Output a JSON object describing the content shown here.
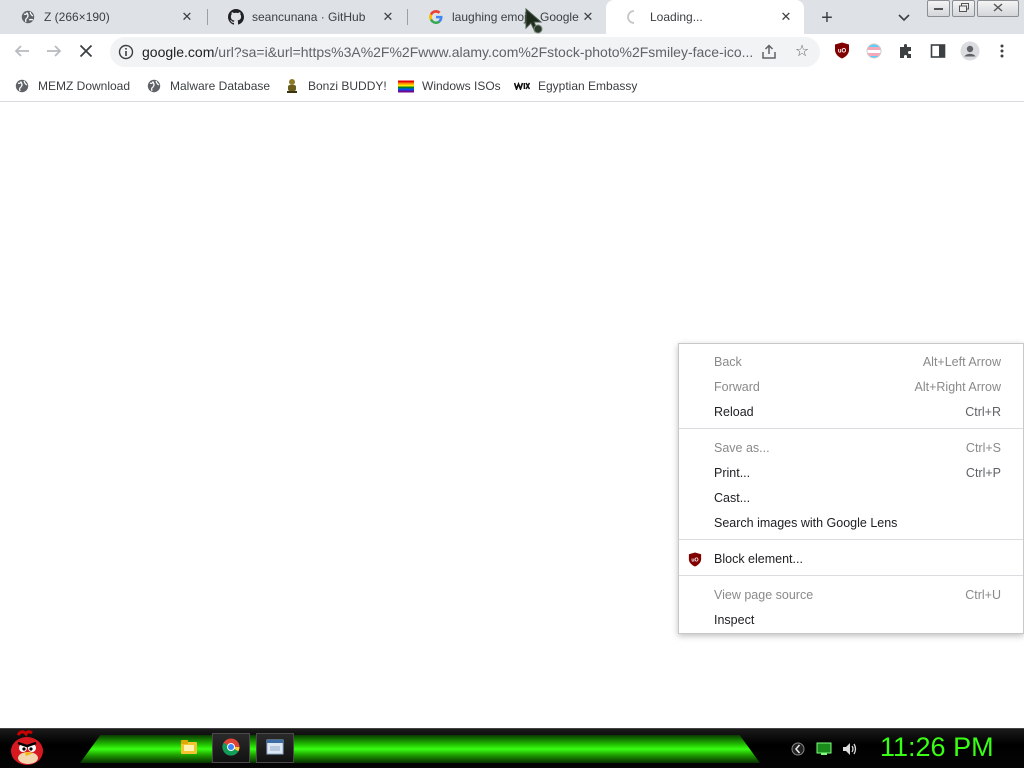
{
  "browser": {
    "tabs": [
      {
        "title": "Z (266×190)",
        "favicon": "globe-icon",
        "active": false
      },
      {
        "title": "seancunana · GitHub",
        "favicon": "github-icon",
        "active": false
      },
      {
        "title": "laughing emoji - Google",
        "favicon": "google-icon",
        "active": false
      },
      {
        "title": "Loading...",
        "favicon": "loading-spinner-icon",
        "active": true
      }
    ],
    "new_tab": "+",
    "address_bar": {
      "host": "google.com",
      "path": "/url?sa=i&url=https%3A%2F%2Fwww.alamy.com%2Fstock-photo%2Fsmiley-face-ico..."
    }
  },
  "bookmarks": [
    {
      "label": "MEMZ Download",
      "icon": "globe-icon"
    },
    {
      "label": "Malware Database",
      "icon": "globe-icon"
    },
    {
      "label": "Bonzi BUDDY!",
      "icon": "bonzi-icon"
    },
    {
      "label": "Windows ISOs",
      "icon": "rainbow-flag-icon"
    },
    {
      "label": "Egyptian Embassy",
      "icon": "wix-icon"
    }
  ],
  "context_menu": {
    "items": [
      {
        "label": "Back",
        "shortcut": "Alt+Left Arrow",
        "disabled": true
      },
      {
        "label": "Forward",
        "shortcut": "Alt+Right Arrow",
        "disabled": true
      },
      {
        "label": "Reload",
        "shortcut": "Ctrl+R",
        "disabled": false
      },
      {
        "label": "Save as...",
        "shortcut": "Ctrl+S",
        "disabled": true
      },
      {
        "label": "Print...",
        "shortcut": "Ctrl+P",
        "disabled": false
      },
      {
        "label": "Cast...",
        "shortcut": "",
        "disabled": false
      },
      {
        "label": "Search images with Google Lens",
        "shortcut": "",
        "disabled": false
      },
      {
        "label": "Block element...",
        "shortcut": "",
        "disabled": false,
        "icon": "ublock-icon"
      },
      {
        "label": "View page source",
        "shortcut": "Ctrl+U",
        "disabled": true
      },
      {
        "label": "Inspect",
        "shortcut": "",
        "disabled": false
      }
    ]
  },
  "taskbar": {
    "clock": "11:26 PM",
    "accent_color": "#39ff14"
  }
}
